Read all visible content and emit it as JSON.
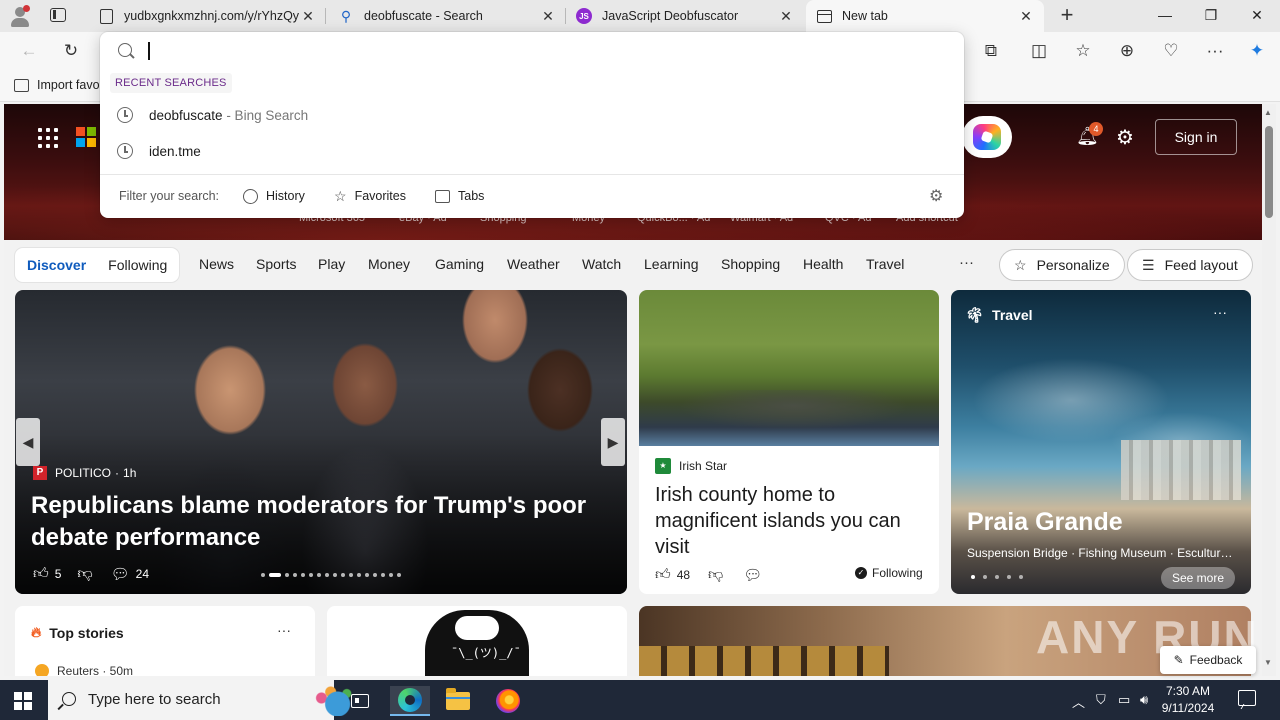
{
  "browser": {
    "tabs": [
      {
        "title": "yudbxgnkxmzhnj.com/y/rYhzQy",
        "favicon": "page-icon"
      },
      {
        "title": "deobfuscate - Search",
        "favicon": "search-icon"
      },
      {
        "title": "JavaScript Deobfuscator",
        "favicon": "js-icon",
        "favicon_text": "JS"
      },
      {
        "title": "New tab",
        "favicon": "newtab-icon",
        "active": true
      }
    ],
    "favorites_bar": {
      "import_label": "Import favo"
    }
  },
  "omnibox": {
    "value": "",
    "recent_label": "RECENT SEARCHES",
    "suggestions": [
      {
        "text": "deobfuscate",
        "sub": " - Bing Search"
      },
      {
        "text": "iden.tme",
        "sub": ""
      }
    ],
    "filter_label": "Filter your search:",
    "filters": [
      "History",
      "Favorites",
      "Tabs"
    ]
  },
  "newtab": {
    "shortcut_labels": [
      "Microsoft 365",
      "eBay · Ad",
      "Shopping",
      "Money",
      "QuickBo... · Ad",
      "Walmart · Ad",
      "QVC · Ad",
      "Add shortcut"
    ],
    "notification_count": "4",
    "sign_in": "Sign in",
    "feed_tabs": {
      "discover": "Discover",
      "following": "Following"
    },
    "nav_links": [
      "News",
      "Sports",
      "Play",
      "Money",
      "Gaming",
      "Weather",
      "Watch",
      "Learning",
      "Shopping",
      "Health",
      "Travel"
    ],
    "more": "···",
    "personalize": "Personalize",
    "feed_layout": "Feed layout",
    "main_card": {
      "source": "POLITICO",
      "source_logo": "P",
      "age": "1h",
      "headline": "Republicans blame moderators for Trump's poor debate performance",
      "likes": "5",
      "comments": "24"
    },
    "irish_card": {
      "source": "Irish Star",
      "headline": "Irish county home to magnificent islands you can visit",
      "likes": "48",
      "following": "Following"
    },
    "travel_card": {
      "label": "Travel",
      "title": "Praia Grande",
      "subtitle": "Suspension Bridge · Fishing Museum · Escultura...",
      "see_more": "See more"
    },
    "top_stories": {
      "title": "Top stories",
      "source": "Reuters · 50m"
    },
    "hoodie_text": "¯\\_(ツ)_/¯",
    "watermark": "ANY RUN",
    "feedback": "Feedback"
  },
  "taskbar": {
    "search_placeholder": "Type here to search",
    "time": "7:30 AM",
    "date": "9/11/2024"
  }
}
